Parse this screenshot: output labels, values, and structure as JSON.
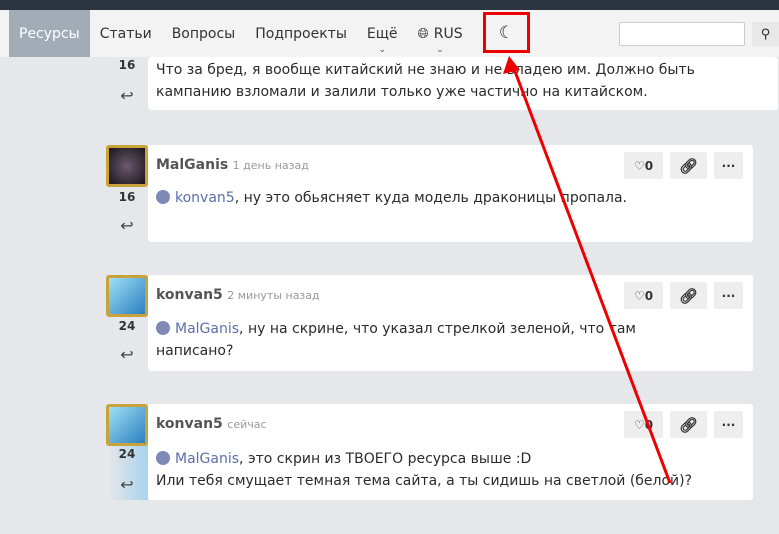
{
  "nav": {
    "items": [
      {
        "label": "Ресурсы",
        "active": true
      },
      {
        "label": "Статьи"
      },
      {
        "label": "Вопросы"
      },
      {
        "label": "Подпроекты"
      },
      {
        "label": "Ещё",
        "dropdown": true
      },
      {
        "label": "RUS",
        "dropdown": true,
        "icon": "globe-icon"
      }
    ],
    "theme_icon": "moon-icon",
    "search": {
      "value": "",
      "placeholder": ""
    },
    "search_icon": "search-icon"
  },
  "annotation_color": "#e00000",
  "comments": [
    {
      "score": "16",
      "text": "Что за бред, я вообще китайский не знаю и не владею им. Должно быть кампанию взломали и залили только уже частично на китайском."
    },
    {
      "author": "MalGanis",
      "time": "1 день назад",
      "score": "16",
      "likes": "0",
      "mention": "konvan5",
      "text": ", ну это обьясняет куда модель драконицы пропала."
    },
    {
      "author": "konvan5",
      "time": "2 минуты назад",
      "score": "24",
      "likes": "0",
      "mention": "MalGanis",
      "text": ", ну на скрине, что указал стрелкой зеленой, что там написано?"
    },
    {
      "author": "konvan5",
      "time": "сейчас",
      "score": "24",
      "likes": "0",
      "mention": "MalGanis",
      "text": ", это скрин из ТВОЕГО ресурса выше :D",
      "text2": "Или тебя смущает темная тема сайта, а ты сидишь на светлой (белой)?"
    }
  ]
}
